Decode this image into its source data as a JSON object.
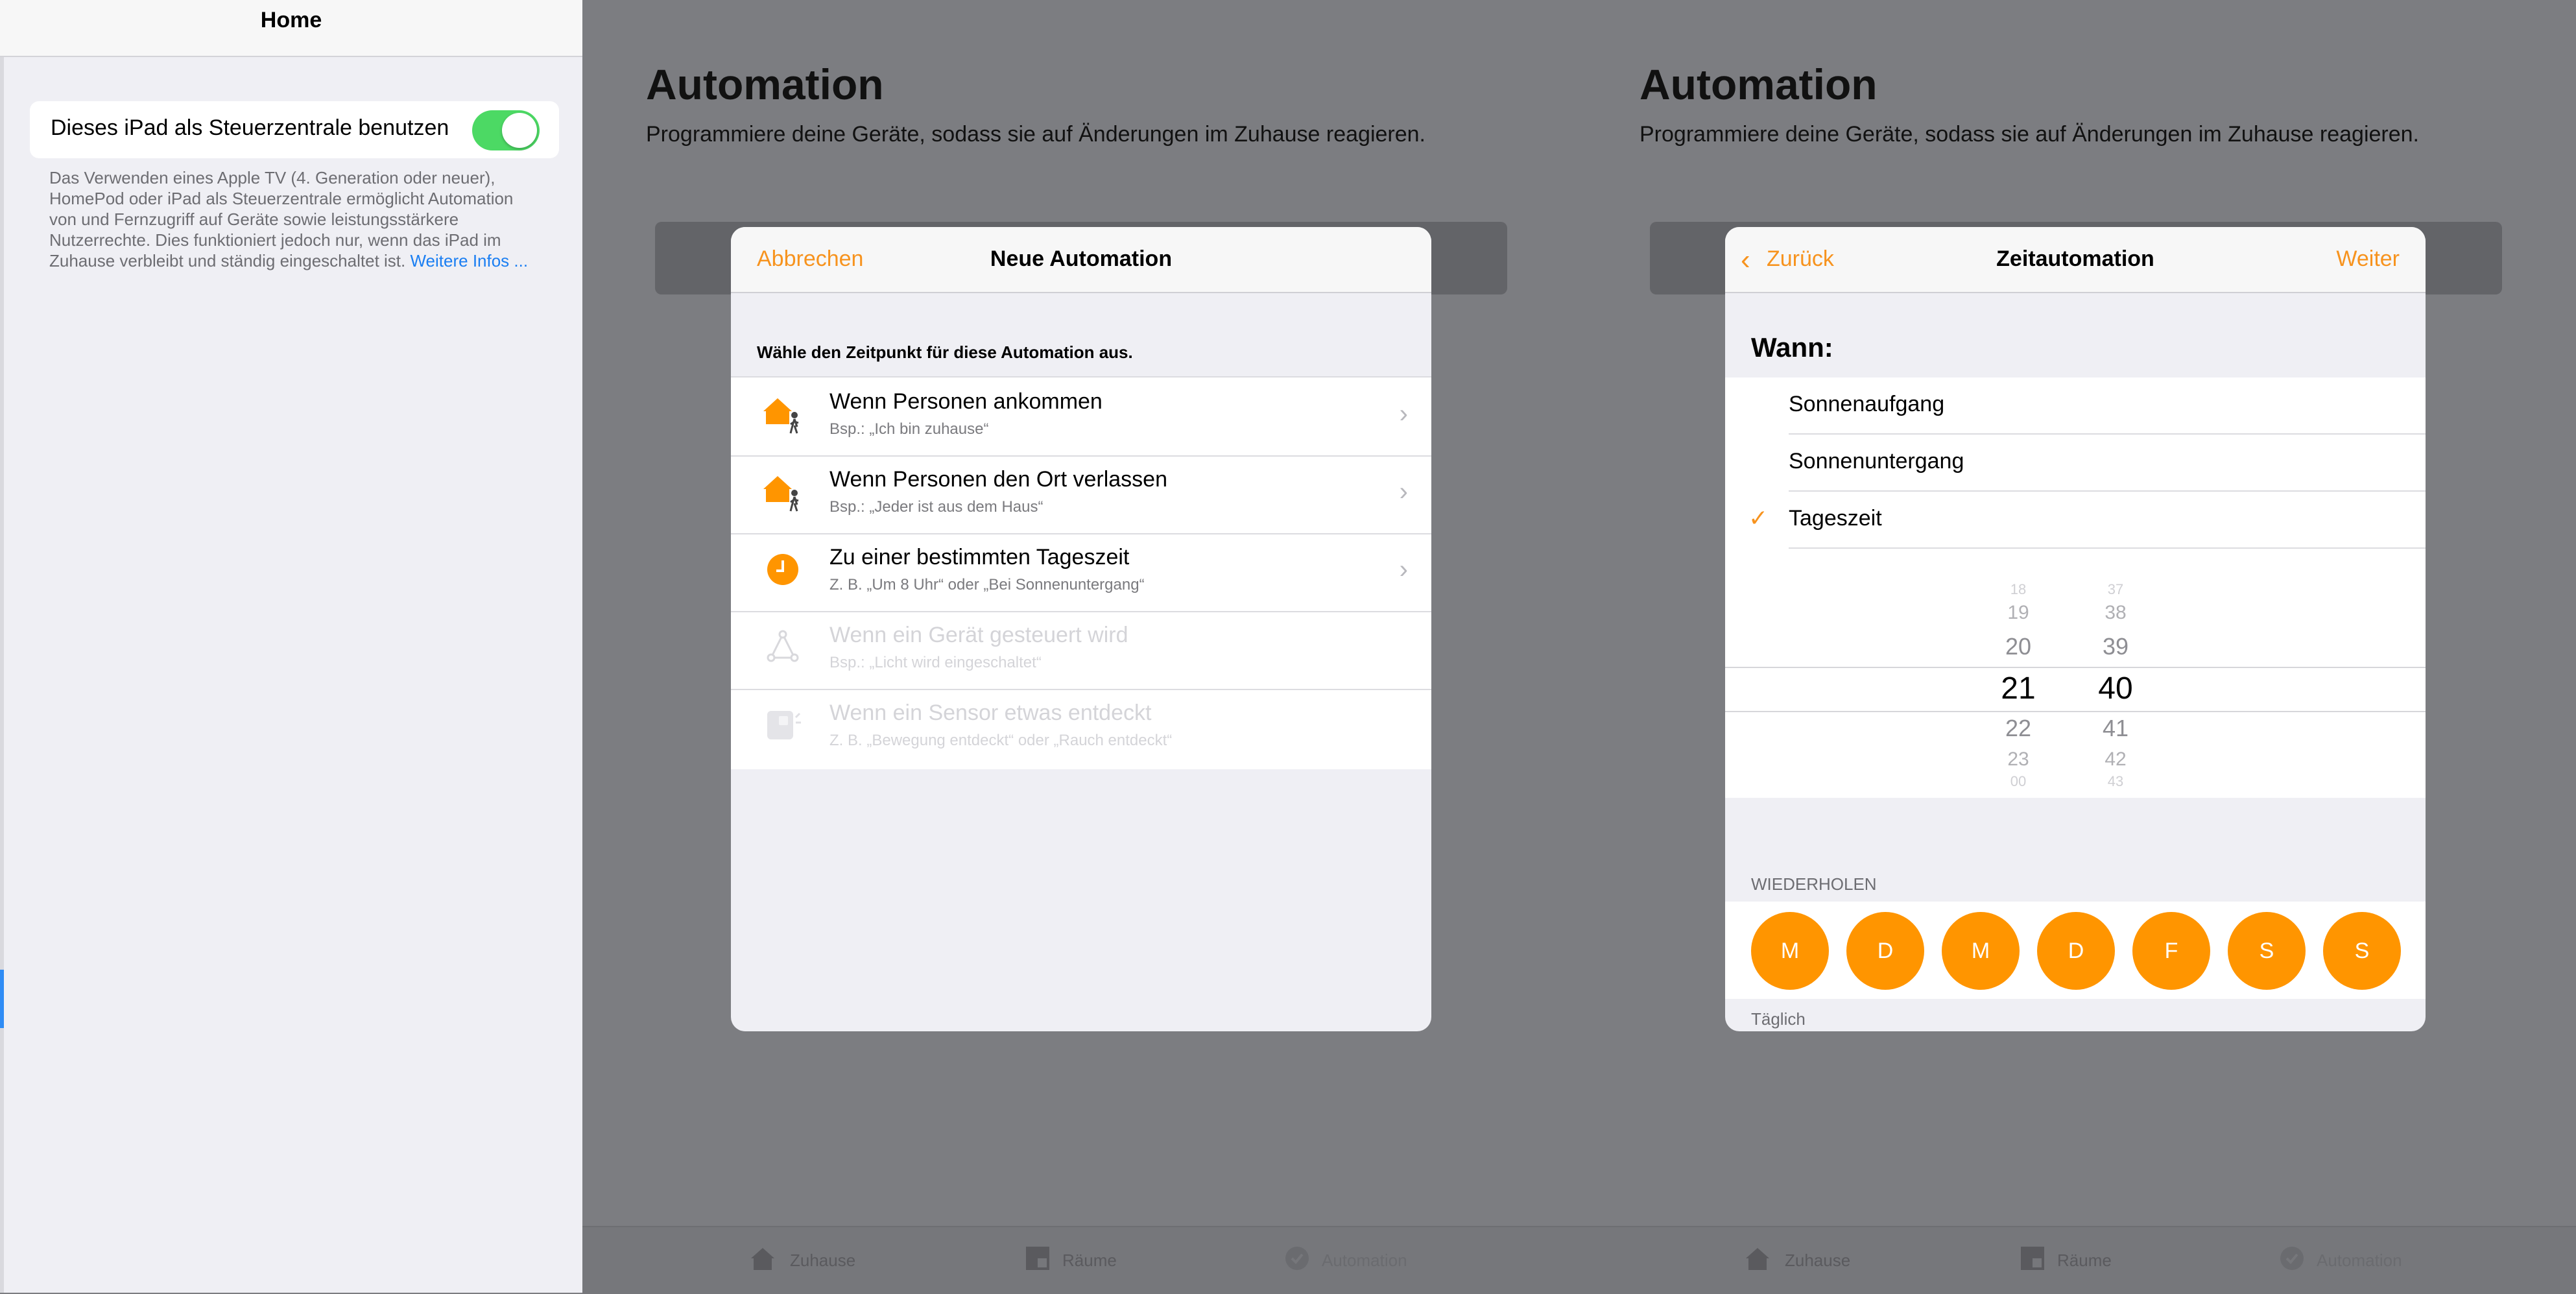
{
  "settings": {
    "title": "Home",
    "toggle_label": "Dieses iPad als Steuerzentrale benutzen",
    "toggle_on": true,
    "footnote": "Das Verwenden eines Apple TV (4. Generation oder neuer), HomePod oder iPad als Steuerzentrale ermöglicht Automation von und Fernzugriff auf Geräte sowie leistungsstärkere Nutzerrechte. Dies funktioniert jedoch nur, wenn das iPad im Zuhause verbleibt und ständig eingeschaltet ist.",
    "more_link": "Weitere Infos ..."
  },
  "screen_left": {
    "title": "Automation",
    "subtitle": "Programmiere deine Geräte, sodass sie auf Änderungen im Zuhause reagieren."
  },
  "screen_right": {
    "title": "Automation",
    "subtitle": "Programmiere deine Geräte, sodass sie auf Änderungen im Zuhause reagieren."
  },
  "new_automation": {
    "cancel": "Abbrechen",
    "title": "Neue Automation",
    "prompt": "Wähle den Zeitpunkt für diese Automation aus.",
    "options": [
      {
        "title": "Wenn Personen ankommen",
        "subtitle": "Bsp.: „Ich bin zuhause“",
        "icon": "home-person-icon",
        "enabled": true
      },
      {
        "title": "Wenn Personen den Ort verlassen",
        "subtitle": "Bsp.: „Jeder ist aus dem Haus“",
        "icon": "home-person-icon",
        "enabled": true
      },
      {
        "title": "Zu einer bestimmten Tageszeit",
        "subtitle": "Z. B. „Um 8 Uhr“ oder „Bei Sonnenuntergang“",
        "icon": "clock-icon",
        "enabled": true
      },
      {
        "title": "Wenn ein Gerät gesteuert wird",
        "subtitle": "Bsp.: „Licht wird eingeschaltet“",
        "icon": "device-icon",
        "enabled": false
      },
      {
        "title": "Wenn ein Sensor etwas entdeckt",
        "subtitle": "Z. B. „Bewegung entdeckt“ oder „Rauch entdeckt“",
        "icon": "sensor-icon",
        "enabled": false
      }
    ]
  },
  "time_automation": {
    "back": "Zurück",
    "title": "Zeitautomation",
    "next": "Weiter",
    "when_label": "Wann:",
    "choices": [
      "Sonnenaufgang",
      "Sonnenuntergang",
      "Tageszeit"
    ],
    "selected_choice": "Tageszeit",
    "hours": [
      "18",
      "19",
      "20",
      "21",
      "22",
      "23",
      "00"
    ],
    "minutes": [
      "37",
      "38",
      "39",
      "40",
      "41",
      "42",
      "43"
    ],
    "selected_hour": "21",
    "selected_minute": "40",
    "repeat_label": "WIEDERHOLEN",
    "days": [
      "M",
      "D",
      "M",
      "D",
      "F",
      "S",
      "S"
    ],
    "repeat_summary": "Täglich"
  },
  "tabs": [
    "Zuhause",
    "Räume",
    "Automation"
  ],
  "colors": {
    "accent": "#ff9500",
    "toggle": "#4cd964",
    "link": "#1a7ef2",
    "dim_background": "#7c7d81"
  }
}
